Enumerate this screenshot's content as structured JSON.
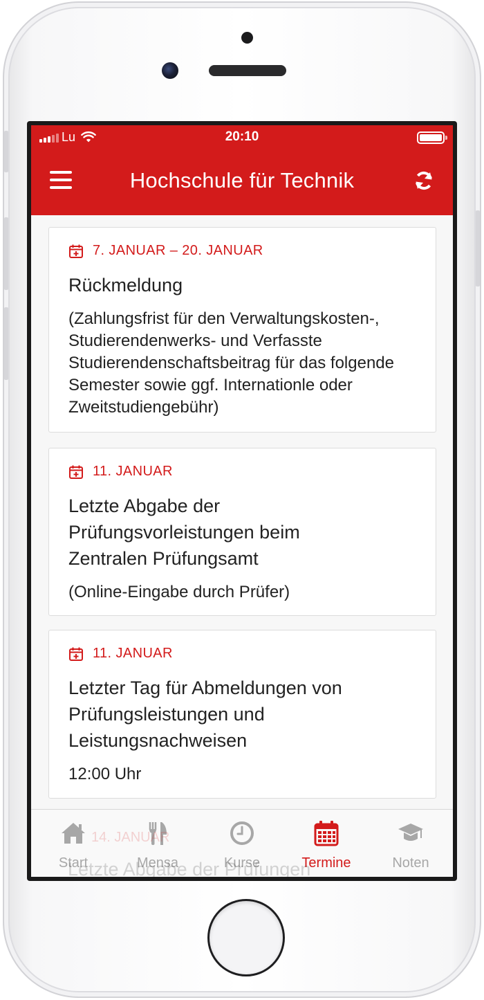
{
  "status_bar": {
    "carrier": "Lu",
    "time": "20:10"
  },
  "header": {
    "title": "Hochschule für Technik"
  },
  "events": [
    {
      "date": "7. JANUAR – 20. JANUAR",
      "title": "Rückmeldung",
      "description": "(Zahlungsfrist für den Verwaltungskosten-, Studierendenwerks- und Verfasste Studierendenschaftsbeitrag für das folgende Semester sowie ggf. Internationle oder Zweitstudiengebühr)"
    },
    {
      "date": "11. JANUAR",
      "title_lines": [
        "Letzte Abgabe der",
        "Prüfungsvorleistungen beim",
        "Zentralen Prüfungsamt"
      ],
      "description": "(Online-Eingabe durch Prüfer)"
    },
    {
      "date": "11. JANUAR",
      "title_lines": [
        "Letzter Tag für Abmeldungen von",
        "Prüfungsleistungen und",
        "Leistungsnachweisen"
      ],
      "description": "12:00 Uhr"
    },
    {
      "date": "14. JANUAR",
      "title": "Letzte Abgabe der Prüfungen"
    }
  ],
  "tabs": [
    {
      "label": "Start",
      "icon": "home-icon"
    },
    {
      "label": "Mensa",
      "icon": "cutlery-icon"
    },
    {
      "label": "Kurse",
      "icon": "clock-icon"
    },
    {
      "label": "Termine",
      "icon": "calendar-icon",
      "active": true
    },
    {
      "label": "Noten",
      "icon": "graduation-cap-icon"
    }
  ],
  "colors": {
    "accent": "#d31b1b",
    "inactive_tab": "#a7a7a7",
    "background": "#f7f7f7"
  }
}
